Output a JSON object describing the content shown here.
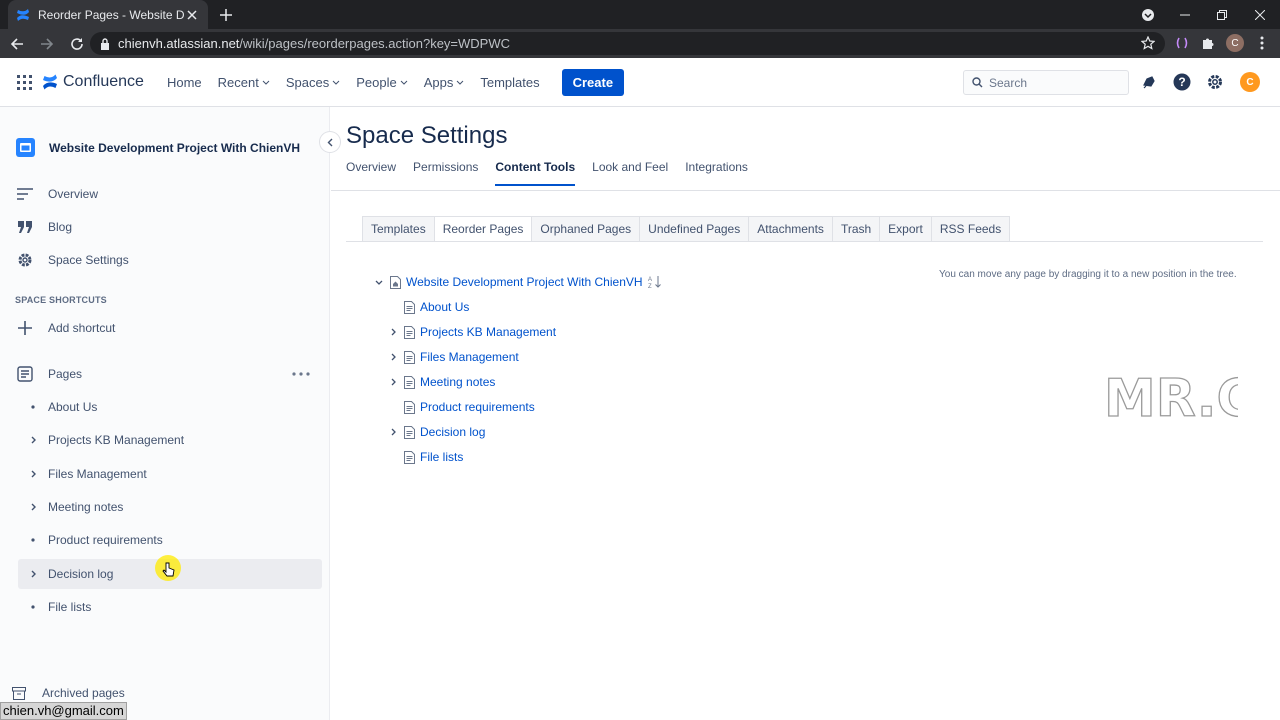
{
  "browser": {
    "tab_title": "Reorder Pages - Website Develop",
    "url_domain": "chienvh.atlassian.net",
    "url_path": "/wiki/pages/reorderpages.action?key=WDPWC",
    "profile_initial": "C"
  },
  "topnav": {
    "logo": "Confluence",
    "items": [
      "Home",
      "Recent",
      "Spaces",
      "People",
      "Apps",
      "Templates"
    ],
    "create": "Create",
    "search_placeholder": "Search",
    "avatar_initial": "C"
  },
  "sidebar": {
    "space_name": "Website Development Project With ChienVH",
    "items": [
      "Overview",
      "Blog",
      "Space Settings"
    ],
    "shortcuts_heading": "SPACE SHORTCUTS",
    "add_shortcut": "Add shortcut",
    "pages_label": "Pages",
    "pages": [
      {
        "label": "About Us",
        "expandable": false
      },
      {
        "label": "Projects KB Management",
        "expandable": true
      },
      {
        "label": "Files Management",
        "expandable": true
      },
      {
        "label": "Meeting notes",
        "expandable": true
      },
      {
        "label": "Product requirements",
        "expandable": false
      },
      {
        "label": "Decision log",
        "expandable": true
      },
      {
        "label": "File lists",
        "expandable": false
      }
    ],
    "archived": "Archived pages"
  },
  "status_bar": "chien.vh@gmail.com",
  "main": {
    "title": "Space Settings",
    "tabs": [
      "Overview",
      "Permissions",
      "Content Tools",
      "Look and Feel",
      "Integrations"
    ],
    "active_tab": "Content Tools",
    "subtabs": [
      "Templates",
      "Reorder Pages",
      "Orphaned Pages",
      "Undefined Pages",
      "Attachments",
      "Trash",
      "Export",
      "RSS Feeds"
    ],
    "active_subtab": "Reorder Pages",
    "hint": "You can move any page by dragging it to a new position in the tree.",
    "tree_root": "Website Development Project With ChienVH",
    "tree_children": [
      {
        "label": "About Us",
        "expandable": false
      },
      {
        "label": "Projects KB Management",
        "expandable": true
      },
      {
        "label": "Files Management",
        "expandable": true
      },
      {
        "label": "Meeting notes",
        "expandable": true
      },
      {
        "label": "Product requirements",
        "expandable": false
      },
      {
        "label": "Decision log",
        "expandable": true
      },
      {
        "label": "File lists",
        "expandable": false
      }
    ],
    "watermark": "MR.C"
  },
  "colors": {
    "brand": "#0052cc",
    "link": "#0052cc",
    "avatar": "#ff991f"
  }
}
